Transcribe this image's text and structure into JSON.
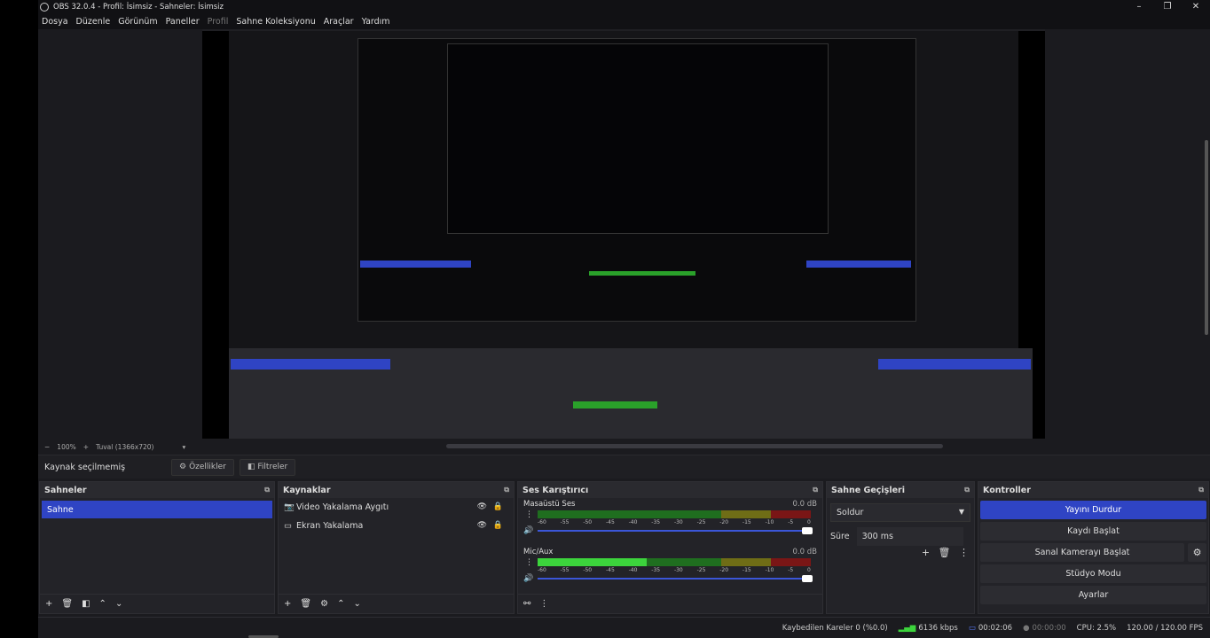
{
  "window": {
    "title": "OBS 32.0.4 - Profil: İsimsiz - Sahneler: İsimsiz",
    "minimize": "–",
    "maximize": "❐",
    "close": "✕"
  },
  "menu": [
    "Dosya",
    "Düzenle",
    "Görünüm",
    "Paneller",
    "Profil",
    "Sahne Koleksiyonu",
    "Araçlar",
    "Yardım"
  ],
  "zoom": {
    "minus": "−",
    "level": "100%",
    "plus": "+",
    "canvas": "Tuval (1366x720)",
    "dropdown": "▾"
  },
  "source_bar": {
    "label": "Kaynak seçilmemiş",
    "properties": "Özellikler",
    "filters": "Filtreler"
  },
  "scenes": {
    "title": "Sahneler",
    "items": [
      "Sahne"
    ]
  },
  "sources": {
    "title": "Kaynaklar",
    "items": [
      {
        "icon": "camera-icon",
        "label": "Video Yakalama Aygıtı"
      },
      {
        "icon": "monitor-icon",
        "label": "Ekran Yakalama"
      }
    ]
  },
  "mixer": {
    "title": "Ses Karıştırıcı",
    "channels": [
      {
        "name": "Masaüstü Ses",
        "db": "0.0 dB",
        "level": 0
      },
      {
        "name": "Mic/Aux",
        "db": "0.0 dB",
        "level": 0.4
      }
    ],
    "ticks": [
      "-60",
      "-55",
      "-50",
      "-45",
      "-40",
      "-35",
      "-30",
      "-25",
      "-20",
      "-15",
      "-10",
      "-5",
      "0"
    ]
  },
  "transitions": {
    "title": "Sahne Geçişleri",
    "selected": "Soldur",
    "duration_label": "Süre",
    "duration_value": "300 ms"
  },
  "controls": {
    "title": "Kontroller",
    "stop_stream": "Yayını Durdur",
    "start_recording": "Kaydı Başlat",
    "start_virtual_cam": "Sanal Kamerayı Başlat",
    "studio_mode": "Stüdyo Modu",
    "settings": "Ayarlar"
  },
  "status": {
    "dropped_frames": "Kaybedilen Kareler 0 (%0.0)",
    "bitrate": "6136 kbps",
    "stream_time": "00:02:06",
    "record_time": "00:00:00",
    "cpu": "CPU: 2.5%",
    "fps": "120.00 / 120.00 FPS"
  },
  "colors": {
    "accent": "#2f44c4",
    "meter_green": "#1f6e1f",
    "meter_yellow": "#6f6d16",
    "meter_red": "#7a1616",
    "meter_level": "#3cd43c"
  }
}
